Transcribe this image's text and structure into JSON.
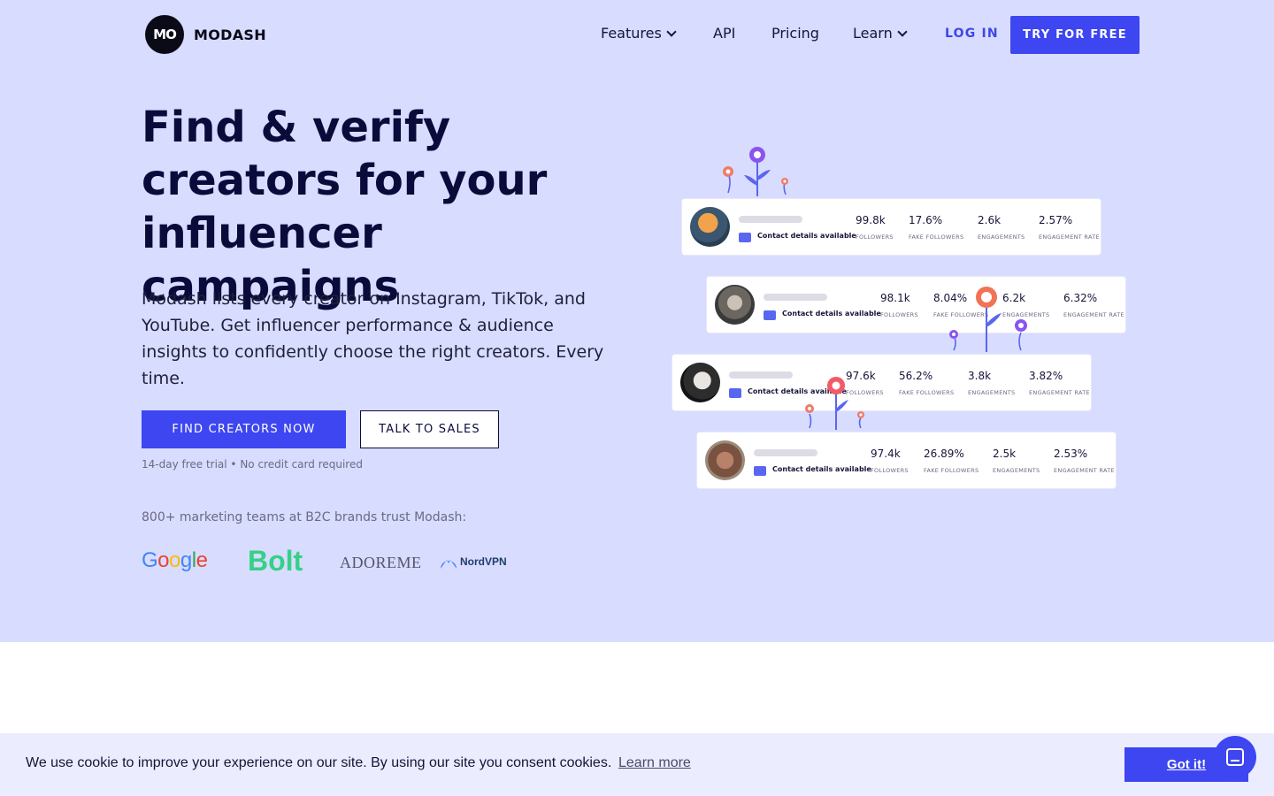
{
  "nav": {
    "logo_mark": "MO",
    "logo_text": "MODASH",
    "items": [
      {
        "label": "Features"
      },
      {
        "label": "API"
      },
      {
        "label": "Pricing"
      },
      {
        "label": "Learn"
      }
    ],
    "login_label": "LOG IN",
    "try_label": "TRY FOR FREE"
  },
  "hero": {
    "headline": "Find & verify creators for your influencer campaigns",
    "subtext": "Modash lists every creator on Instagram, TikTok, and YouTube. Get influencer performance & audience insights to confidently choose the right creators. Every time.",
    "primary_cta": "FIND CREATORS NOW",
    "secondary_cta": "TALK TO SALES",
    "trial_note": "14-day free trial • No credit card required",
    "trust_note": "800+ marketing teams at B2C brands trust Modash:",
    "brands": {
      "google": "Google",
      "bolt": "Bolt",
      "adoreme": "ADOREME",
      "nordvpn": "NordVPN"
    }
  },
  "cards": [
    {
      "contact": "Contact details available",
      "followers": "99.8k",
      "fake_followers": "17.6%",
      "engagements": "2.6k",
      "engagement_rate": "2.57%"
    },
    {
      "contact": "Contact details available",
      "followers": "98.1k",
      "fake_followers": "8.04%",
      "engagements": "6.2k",
      "engagement_rate": "6.32%"
    },
    {
      "contact": "Contact details available",
      "followers": "97.6k",
      "fake_followers": "56.2%",
      "engagements": "3.8k",
      "engagement_rate": "3.82%"
    },
    {
      "contact": "Contact details available",
      "followers": "97.4k",
      "fake_followers": "26.89%",
      "engagements": "2.5k",
      "engagement_rate": "2.53%"
    }
  ],
  "stat_labels": {
    "followers": "FOLLOWERS",
    "fake_followers": "FAKE FOLLOWERS",
    "engagements": "ENGAGEMENTS",
    "engagement_rate": "ENGAGEMENT RATE"
  },
  "cookie": {
    "text": "We use cookie to improve your experience on our site. By using our site you consent cookies.",
    "link": "Learn more",
    "button": "Got it!"
  },
  "colors": {
    "hero_bg": "#d8dcff",
    "accent": "#3d46f0",
    "navy": "#0b0b3b",
    "cookie_bg": "#ebecfe"
  }
}
